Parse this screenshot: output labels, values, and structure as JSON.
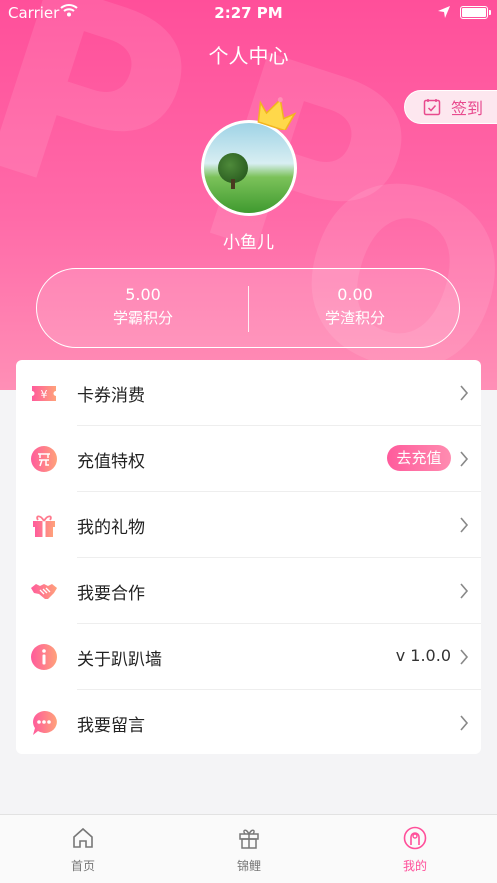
{
  "status_bar": {
    "carrier": "Carrier",
    "time": "2:27 PM"
  },
  "header": {
    "title": "个人中心",
    "signin_label": "签到"
  },
  "profile": {
    "username": "小鱼儿"
  },
  "points": {
    "left": {
      "value": "5.00",
      "label": "学霸积分"
    },
    "right": {
      "value": "0.00",
      "label": "学渣积分"
    }
  },
  "menu": {
    "items": [
      {
        "label": "卡券消费",
        "icon": "ticket-icon"
      },
      {
        "label": "充值特权",
        "icon": "recharge-icon",
        "badge": "去充值"
      },
      {
        "label": "我的礼物",
        "icon": "gift-icon"
      },
      {
        "label": "我要合作",
        "icon": "handshake-icon"
      },
      {
        "label": "关于趴趴墙",
        "icon": "info-icon",
        "value": "v 1.0.0"
      },
      {
        "label": "我要留言",
        "icon": "message-icon"
      }
    ]
  },
  "tabbar": {
    "tabs": [
      {
        "label": "首页",
        "icon": "home-icon"
      },
      {
        "label": "锦鲤",
        "icon": "gift-box-icon"
      },
      {
        "label": "我的",
        "icon": "profile-icon"
      }
    ],
    "active": 2
  },
  "colors": {
    "accent": "#ff4f9a",
    "accent_light": "#ff8fb6",
    "text": "#222222"
  },
  "watermark_text": [
    "P",
    "P",
    "O"
  ]
}
